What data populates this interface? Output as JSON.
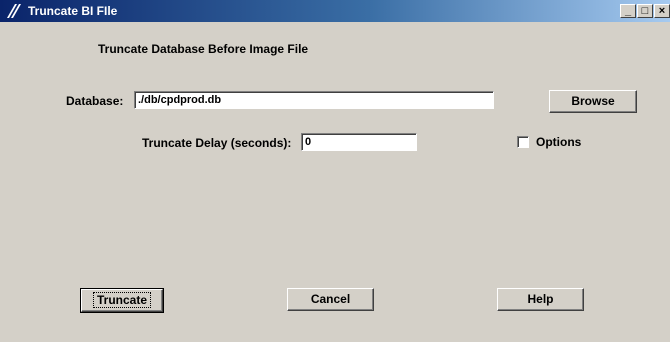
{
  "window": {
    "title": "Truncate BI FIle",
    "minimize_glyph": "_",
    "maximize_glyph": "□",
    "close_glyph": "×"
  },
  "heading": "Truncate Database Before Image File",
  "database": {
    "label": "Database:",
    "value": "./db/cpdprod.db"
  },
  "browse_label": "Browse",
  "delay": {
    "label": "Truncate Delay (seconds):",
    "value": "0"
  },
  "options": {
    "label": "Options",
    "checked": false
  },
  "buttons": {
    "truncate": "Truncate",
    "cancel": "Cancel",
    "help": "Help"
  },
  "colors": {
    "title_start": "#0a246a",
    "title_end": "#a6caf0",
    "face": "#d4d0c8"
  }
}
